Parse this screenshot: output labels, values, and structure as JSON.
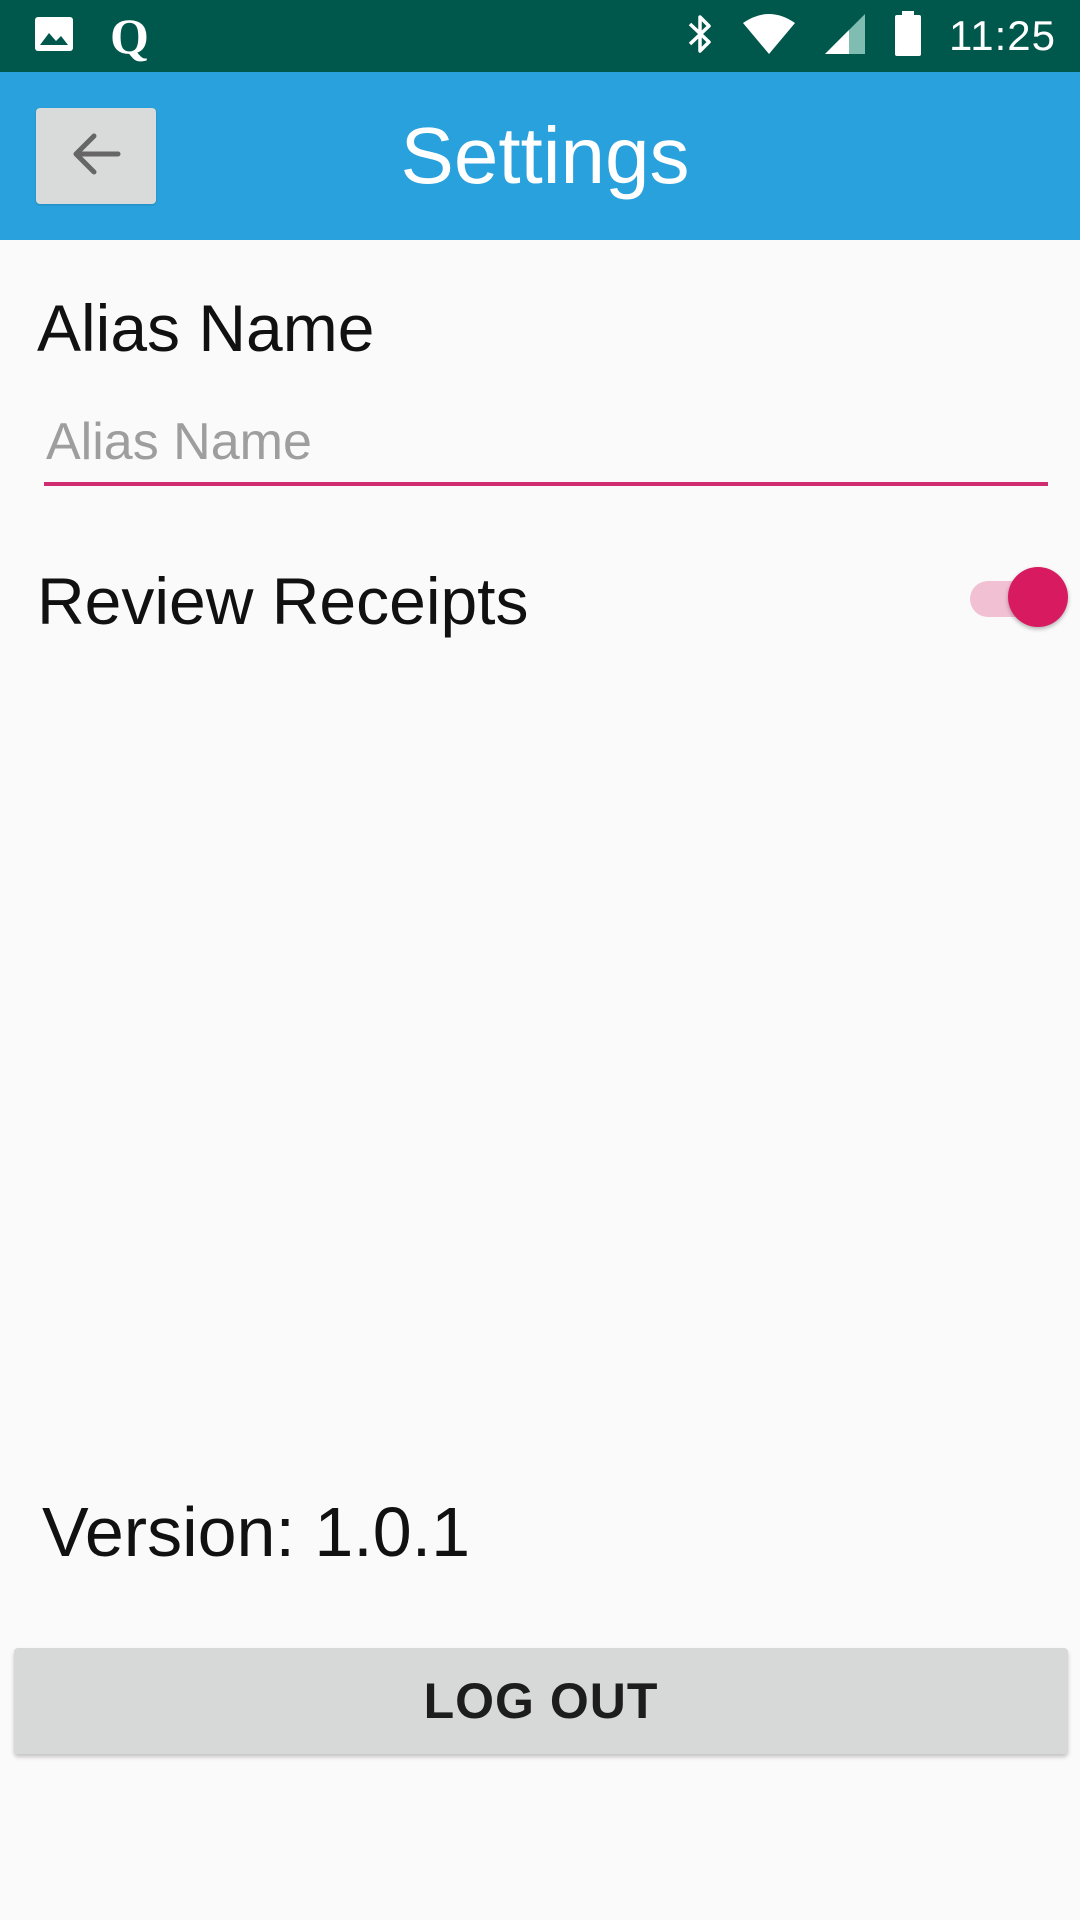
{
  "status_bar": {
    "time": "11:25",
    "left_icons": [
      "image-icon",
      "q-app-icon"
    ],
    "right_icons": [
      "bluetooth-icon",
      "wifi-icon",
      "cell-signal-icon",
      "battery-icon"
    ],
    "q_glyph": "Q"
  },
  "app_bar": {
    "title": "Settings",
    "back_icon": "arrow-left-icon"
  },
  "alias": {
    "label": "Alias Name",
    "placeholder": "Alias Name",
    "value": ""
  },
  "review_receipts": {
    "label": "Review Receipts",
    "enabled": true
  },
  "footer": {
    "version": "Version: 1.0.1",
    "logout_label": "LOG OUT"
  },
  "colors": {
    "status_bar": "#00574b",
    "app_bar": "#29a1dd",
    "accent": "#d81b60",
    "button_bg": "#d7d8d8"
  }
}
